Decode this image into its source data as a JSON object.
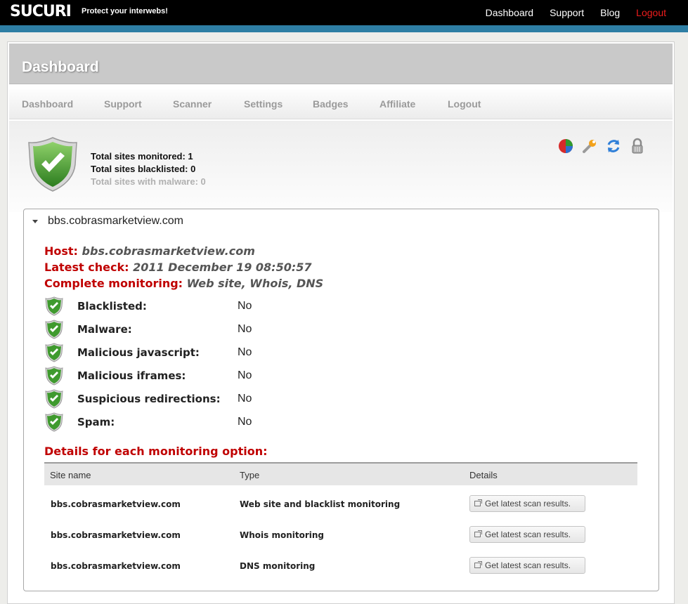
{
  "topbar": {
    "logo": "SUCURI",
    "tagline": "Protect your interwebs!",
    "nav": [
      "Dashboard",
      "Support",
      "Blog",
      "Logout"
    ]
  },
  "page": {
    "title": "Dashboard",
    "nav": [
      "Dashboard",
      "Support",
      "Scanner",
      "Settings",
      "Badges",
      "Affiliate",
      "Logout"
    ]
  },
  "summary": {
    "monitored": "Total sites monitored: 1",
    "blacklisted": "Total sites blacklisted: 0",
    "malware": "Total sites with malware: 0",
    "tools": [
      "pie-chart-icon",
      "wrench-icon",
      "refresh-icon",
      "lock-icon"
    ]
  },
  "site": {
    "name": "bbs.cobrasmarketview.com",
    "host_label": "Host:",
    "host_value": "bbs.cobrasmarketview.com",
    "check_label": "Latest check:",
    "check_value": "2011 December 19 08:50:57",
    "monitoring_label": "Complete monitoring:",
    "monitoring_value": "Web site, Whois, DNS",
    "checks": [
      {
        "label": "Blacklisted:",
        "value": "No"
      },
      {
        "label": "Malware:",
        "value": "No"
      },
      {
        "label": "Malicious javascript:",
        "value": "No"
      },
      {
        "label": "Malicious iframes:",
        "value": "No"
      },
      {
        "label": "Suspicious redirections:",
        "value": "No"
      },
      {
        "label": "Spam:",
        "value": "No"
      }
    ],
    "details_title": "Details for each monitoring option:",
    "table": {
      "headers": [
        "Site name",
        "Type",
        "Details"
      ],
      "rows": [
        {
          "site": "bbs.cobrasmarketview.com",
          "type": "Web site and blacklist monitoring",
          "action": "Get latest scan results."
        },
        {
          "site": "bbs.cobrasmarketview.com",
          "type": "Whois monitoring",
          "action": "Get latest scan results."
        },
        {
          "site": "bbs.cobrasmarketview.com",
          "type": "DNS monitoring",
          "action": "Get latest scan results."
        }
      ]
    }
  },
  "colors": {
    "accent_red": "#c00000",
    "blue_bar": "#2e7ea4",
    "shield_green": "#3f9a2e"
  }
}
